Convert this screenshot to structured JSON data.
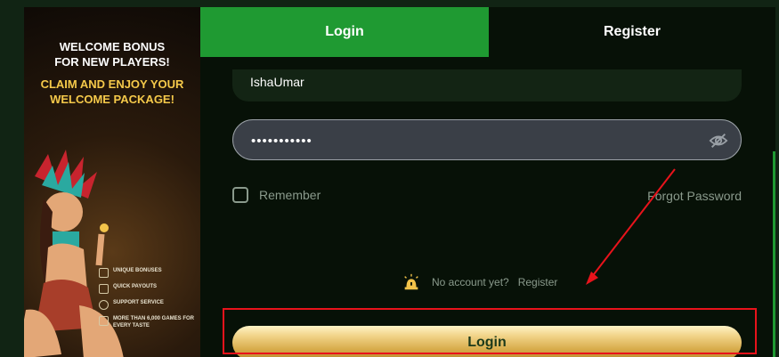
{
  "promo": {
    "title_line1": "WELCOME BONUS",
    "title_line2": "FOR NEW PLAYERS!",
    "sub_line1": "CLAIM AND ENJOY YOUR",
    "sub_line2": "WELCOME PACKAGE!",
    "features": [
      {
        "icon": "gift-icon",
        "label": "UNIQUE BONUSES"
      },
      {
        "icon": "payout-icon",
        "label": "QUICK PAYOUTS"
      },
      {
        "icon": "headset-icon",
        "label": "SUPPORT SERVICE"
      },
      {
        "icon": "slots-icon",
        "label": "MORE THAN 6,000 GAMES FOR EVERY TASTE"
      }
    ]
  },
  "tabs": {
    "login": "Login",
    "register": "Register"
  },
  "form": {
    "username_value": "IshaUmar",
    "password_value": "•••••••••••",
    "remember_label": "Remember",
    "forgot_label": "Forgot Password",
    "no_account_text": "No account yet?",
    "register_link": "Register",
    "login_button": "Login"
  },
  "colors": {
    "active_tab": "#1f9a32",
    "button_gold": "#d7ab4a",
    "annotation_red": "#e8131b"
  }
}
